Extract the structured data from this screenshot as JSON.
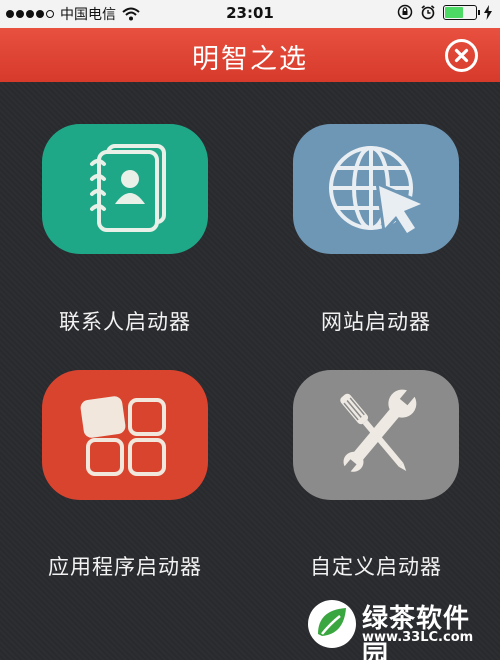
{
  "status_bar": {
    "carrier": "中国电信",
    "time": "23:01",
    "signal_dots": 5,
    "battery_level": 0.55
  },
  "header": {
    "title": "明智之选",
    "background_color": "#e0463a"
  },
  "launchers": [
    {
      "label": "联系人启动器",
      "icon": "contacts-book-icon",
      "color": "#1fa888"
    },
    {
      "label": "网站启动器",
      "icon": "globe-cursor-icon",
      "color": "#6e97b6"
    },
    {
      "label": "应用程序启动器",
      "icon": "app-grid-icon",
      "color": "#d9442f"
    },
    {
      "label": "自定义启动器",
      "icon": "tools-icon",
      "color": "#8b8b8b"
    }
  ],
  "watermark": {
    "name": "绿茶软件园",
    "url": "www.33LC.com"
  }
}
